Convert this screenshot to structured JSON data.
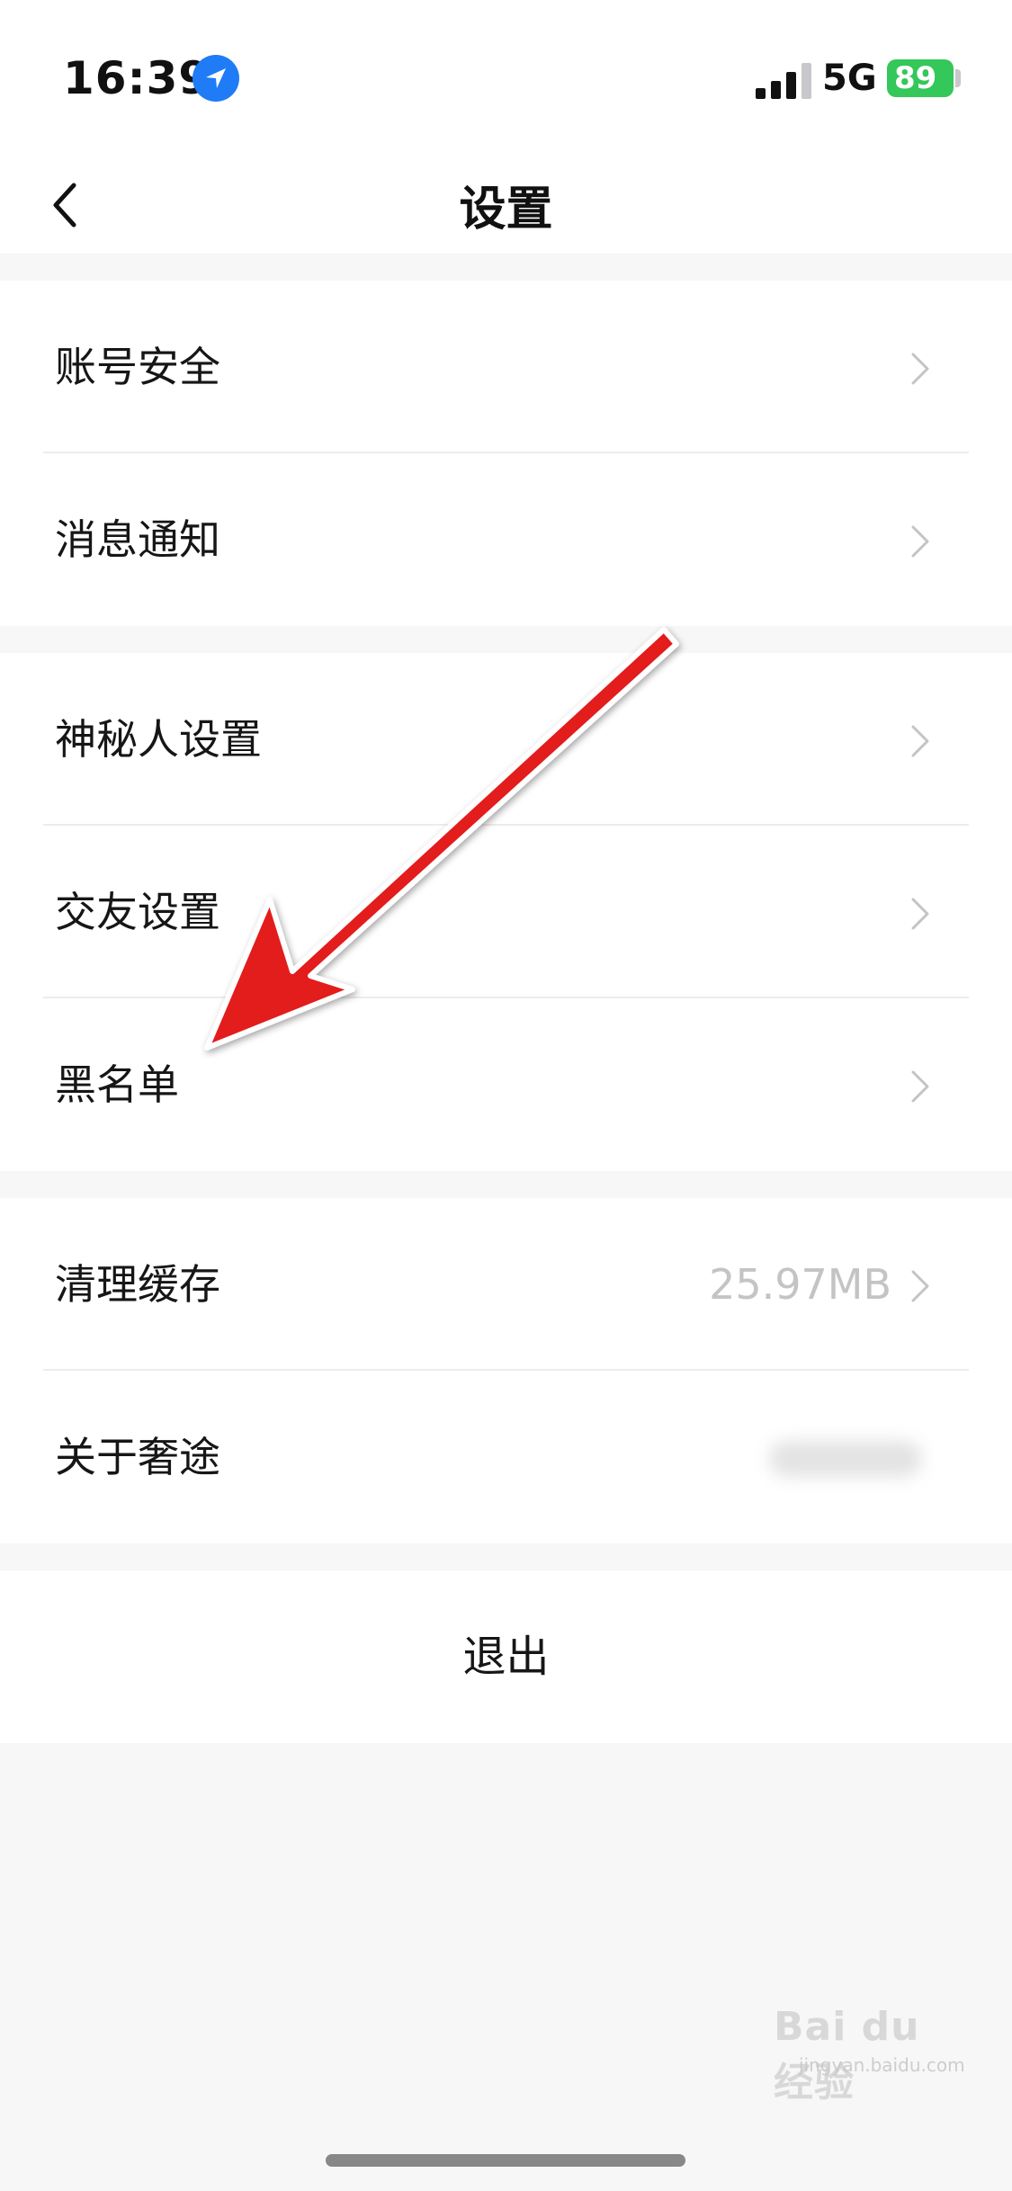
{
  "status_bar": {
    "time": "16:39",
    "network": "5G",
    "battery": "89"
  },
  "nav": {
    "title": "设置"
  },
  "groups": [
    {
      "items": [
        {
          "label": "账号安全"
        },
        {
          "label": "消息通知"
        }
      ]
    },
    {
      "items": [
        {
          "label": "神秘人设置"
        },
        {
          "label": "交友设置"
        },
        {
          "label": "黑名单"
        }
      ]
    },
    {
      "items": [
        {
          "label": "清理缓存",
          "value": "25.97MB"
        },
        {
          "label": "关于奢途"
        }
      ]
    }
  ],
  "logout": {
    "label": "退出"
  },
  "watermark": {
    "text": "Bai du 经验",
    "sub": "jingyan.baidu.com"
  },
  "colors": {
    "background": "#f7f7f7",
    "card": "#ffffff",
    "battery": "#34c759",
    "location": "#1f7cf6",
    "annotation_arrow": "#e31b1b"
  }
}
